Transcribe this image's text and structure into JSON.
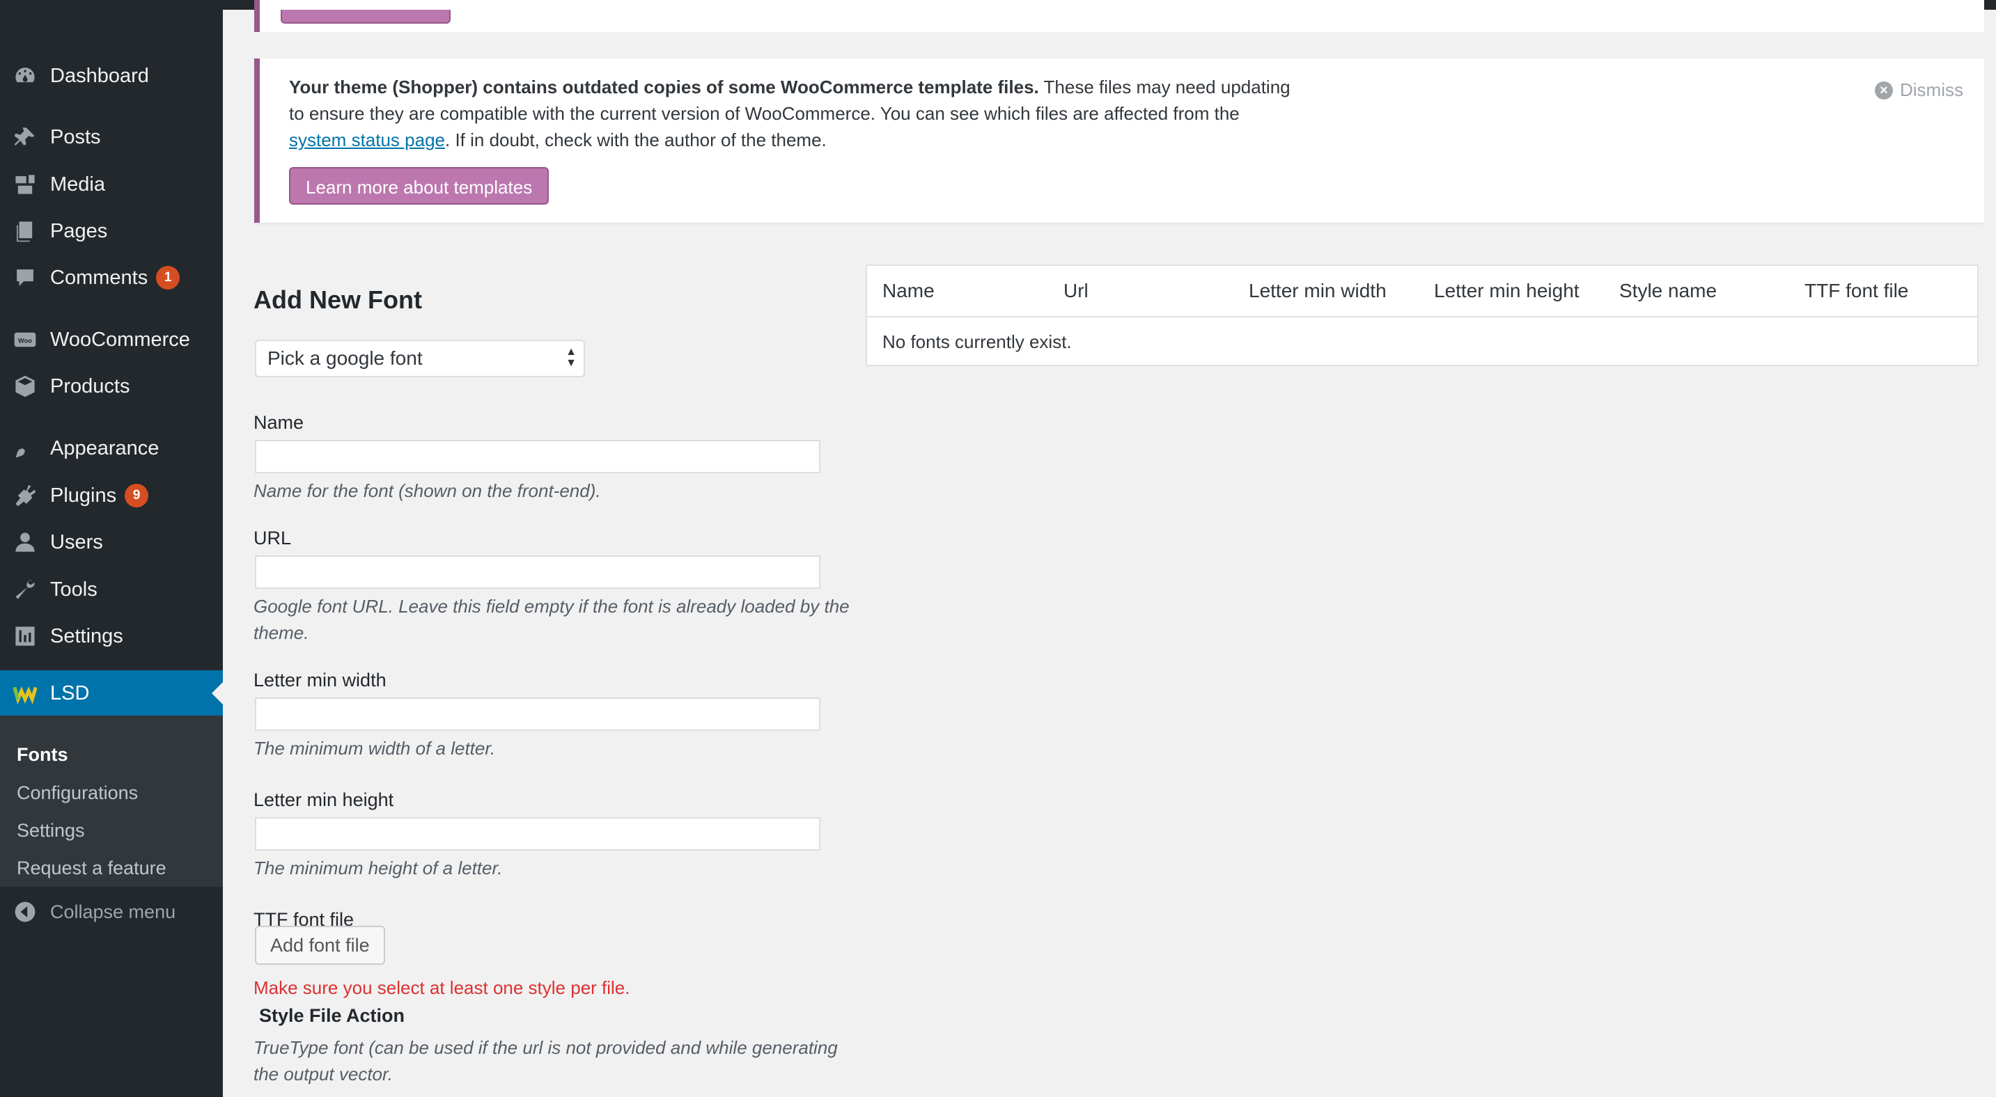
{
  "sidebar": {
    "items": [
      {
        "label": "Dashboard",
        "icon": "dashboard-icon"
      },
      {
        "label": "Posts",
        "icon": "pin-icon"
      },
      {
        "label": "Media",
        "icon": "media-icon"
      },
      {
        "label": "Pages",
        "icon": "pages-icon"
      },
      {
        "label": "Comments",
        "icon": "comment-icon",
        "badge": "1"
      },
      {
        "label": "WooCommerce",
        "icon": "woo-icon"
      },
      {
        "label": "Products",
        "icon": "box-icon"
      },
      {
        "label": "Appearance",
        "icon": "brush-icon"
      },
      {
        "label": "Plugins",
        "icon": "plug-icon",
        "badge": "9"
      },
      {
        "label": "Users",
        "icon": "user-icon"
      },
      {
        "label": "Tools",
        "icon": "wrench-icon"
      },
      {
        "label": "Settings",
        "icon": "settings-icon"
      },
      {
        "label": "LSD",
        "icon": "lsd-logo-icon"
      }
    ],
    "submenu": [
      "Fonts",
      "Configurations",
      "Settings",
      "Request a feature"
    ],
    "collapse_label": "Collapse menu"
  },
  "notice": {
    "bold_text": "Your theme (Shopper) contains outdated copies of some WooCommerce template files.",
    "text_1": " These files may need updating to ensure they are compatible with the current version of WooCommerce. You can see which files are affected from the ",
    "link_text": "system status page",
    "text_2": ". If in doubt, check with the author of the theme.",
    "dismiss_label": "Dismiss",
    "button_label": "Learn more about templates"
  },
  "form": {
    "title": "Add New Font",
    "select_value": "Pick a google font",
    "name_label": "Name",
    "name_desc": "Name for the font (shown on the front-end).",
    "url_label": "URL",
    "url_desc": "Google font URL. Leave this field empty if the font is already loaded by the theme.",
    "width_label": "Letter min width",
    "width_desc": "The minimum width of a letter.",
    "height_label": "Letter min height",
    "height_desc": "The minimum height of a letter.",
    "ttf_label": "TTF font file",
    "add_file_button": "Add font file",
    "warning": "Make sure you select at least one style per file.",
    "style_file_header": "Style File Action",
    "ttf_desc": "TrueType font (can be used if the url is not provided and while generating the output vector."
  },
  "table": {
    "columns": [
      "Name",
      "Url",
      "Letter min width",
      "Letter min height",
      "Style name",
      "TTF font file"
    ],
    "empty_message": "No fonts currently exist."
  },
  "colors": {
    "sidebar_bg": "#23282d",
    "active_bg": "#0073aa",
    "woo_purple": "#96588a",
    "badge": "#d54e21",
    "warning": "#dc3232"
  }
}
